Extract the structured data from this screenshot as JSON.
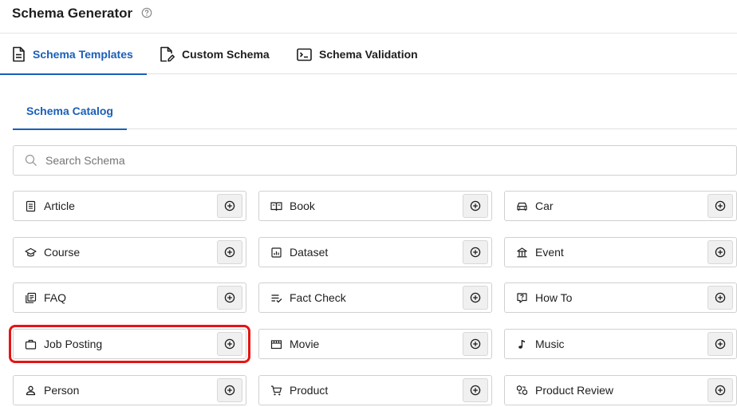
{
  "header": {
    "title": "Schema Generator"
  },
  "tabs": [
    {
      "label": "Schema Templates"
    },
    {
      "label": "Custom Schema"
    },
    {
      "label": "Schema Validation"
    }
  ],
  "subtabs": [
    {
      "label": "Schema Catalog"
    }
  ],
  "search": {
    "placeholder": "Search Schema",
    "value": ""
  },
  "schemas": [
    {
      "label": "Article",
      "icon": "article-icon"
    },
    {
      "label": "Book",
      "icon": "book-icon"
    },
    {
      "label": "Car",
      "icon": "car-icon"
    },
    {
      "label": "Course",
      "icon": "course-icon"
    },
    {
      "label": "Dataset",
      "icon": "dataset-icon"
    },
    {
      "label": "Event",
      "icon": "event-icon"
    },
    {
      "label": "FAQ",
      "icon": "faq-icon"
    },
    {
      "label": "Fact Check",
      "icon": "fact-check-icon"
    },
    {
      "label": "How To",
      "icon": "how-to-icon"
    },
    {
      "label": "Job Posting",
      "icon": "briefcase-icon"
    },
    {
      "label": "Movie",
      "icon": "movie-icon"
    },
    {
      "label": "Music",
      "icon": "music-note-icon"
    },
    {
      "label": "Person",
      "icon": "person-icon"
    },
    {
      "label": "Product",
      "icon": "cart-icon"
    },
    {
      "label": "Product Review",
      "icon": "product-review-icon"
    }
  ],
  "colors": {
    "accent": "#1a5fb8",
    "highlight": "#e81313",
    "border": "#d0d0d0"
  }
}
